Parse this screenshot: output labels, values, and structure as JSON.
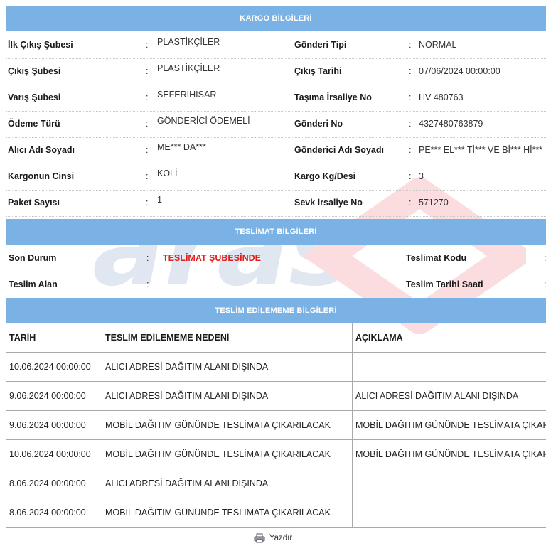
{
  "kargo": {
    "title": "KARGO BİLGİLERİ",
    "rows": [
      {
        "l1": "İlk Çıkış Şubesi",
        "v1": "PLASTİKÇİLER",
        "l2": "Gönderi Tipi",
        "v2": "NORMAL"
      },
      {
        "l1": "Çıkış Şubesi",
        "v1": "PLASTİKÇİLER",
        "l2": "Çıkış Tarihi",
        "v2": "07/06/2024 00:00:00"
      },
      {
        "l1": "Varış Şubesi",
        "v1": "SEFERİHİSAR",
        "l2": "Taşıma İrsaliye No",
        "v2": "HV 480763"
      },
      {
        "l1": "Ödeme Türü",
        "v1": "GÖNDERİCİ ÖDEMELİ",
        "l2": "Gönderi No",
        "v2": "4327480763879"
      },
      {
        "l1": "Alıcı Adı Soyadı",
        "v1": "ME*** DA***",
        "l2": "Gönderici Adı Soyadı",
        "v2": "PE*** EL*** Tİ*** VE Bİ*** Hİ***"
      },
      {
        "l1": "Kargonun Cinsi",
        "v1": "KOLİ",
        "l2": "Kargo Kg/Desi",
        "v2": "3"
      },
      {
        "l1": "Paket Sayısı",
        "v1": "1",
        "l2": "Sevk İrsaliye No",
        "v2": "571270"
      }
    ]
  },
  "teslimat": {
    "title": "TESLİMAT BİLGİLERİ",
    "rows": [
      {
        "l1": "Son Durum",
        "v1": "TESLİMAT ŞUBESİNDE",
        "l2": "Teslimat Kodu"
      },
      {
        "l1": "Teslim Alan",
        "v1": "",
        "l2": "Teslim Tarihi Saati"
      }
    ]
  },
  "teslim_edilememe": {
    "title": "TESLİM EDİLEMEME BİLGİLERİ",
    "headers": [
      "TARİH",
      "TESLİM EDİLEMEME NEDENİ",
      "AÇIKLAMA"
    ],
    "rows": [
      [
        "10.06.2024 00:00:00",
        "ALICI ADRESİ DAĞITIM ALANI DIŞINDA",
        ""
      ],
      [
        "9.06.2024 00:00:00",
        "ALICI ADRESİ DAĞITIM ALANI DIŞINDA",
        "ALICI ADRESİ DAĞITIM ALANI DIŞINDA"
      ],
      [
        "9.06.2024 00:00:00",
        "MOBİL DAĞITIM GÜNÜNDE TESLİMATA ÇIKARILACAK",
        "MOBİL DAĞITIM GÜNÜNDE TESLİMATA ÇIKARILACAK"
      ],
      [
        "10.06.2024 00:00:00",
        "MOBİL DAĞITIM GÜNÜNDE TESLİMATA ÇIKARILACAK",
        "MOBİL DAĞITIM GÜNÜNDE TESLİMATA ÇIKARILACAK"
      ],
      [
        "8.06.2024 00:00:00",
        "ALICI ADRESİ DAĞITIM ALANI DIŞINDA",
        ""
      ],
      [
        "8.06.2024 00:00:00",
        "MOBİL DAĞITIM GÜNÜNDE TESLİMATA ÇIKARILACAK",
        ""
      ]
    ]
  },
  "colon": ":",
  "print_label": "Yazdır",
  "print_icon": "printer-icon",
  "watermark_text": "aras",
  "colors": {
    "header_bg": "#7ab2e6",
    "status_red": "#e0201c",
    "watermark_blue": "#1d4f91",
    "watermark_red": "#e30613"
  }
}
